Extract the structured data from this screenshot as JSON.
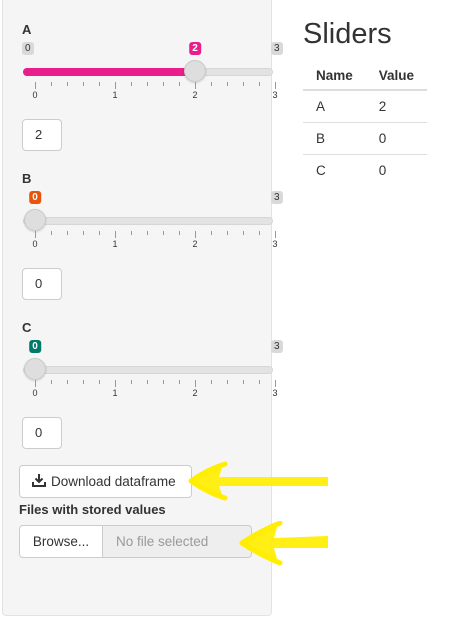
{
  "sliders": [
    {
      "label": "A",
      "min": "0",
      "max": "3",
      "value": 2,
      "value_label": "2",
      "color": "#e91e8c",
      "tick_labels": [
        "0",
        "1",
        "2",
        "3"
      ],
      "input_value": "2"
    },
    {
      "label": "B",
      "min": "0",
      "max": "3",
      "value": 0,
      "value_label": "0",
      "color": "#e8540c",
      "tick_labels": [
        "0",
        "1",
        "2",
        "3"
      ],
      "input_value": "0"
    },
    {
      "label": "C",
      "min": "0",
      "max": "3",
      "value": 0,
      "value_label": "0",
      "color": "#00796b",
      "tick_labels": [
        "0",
        "1",
        "2",
        "3"
      ],
      "input_value": "0"
    }
  ],
  "download_button": {
    "label": "Download dataframe",
    "icon": "download-icon"
  },
  "files": {
    "label": "Files with stored values",
    "browse_label": "Browse...",
    "placeholder": "No file selected"
  },
  "main": {
    "title": "Sliders"
  },
  "table": {
    "headers": [
      "Name",
      "Value"
    ],
    "rows": [
      [
        "A",
        "2"
      ],
      [
        "B",
        "0"
      ],
      [
        "C",
        "0"
      ]
    ]
  },
  "annotation_color": "#ffee00"
}
